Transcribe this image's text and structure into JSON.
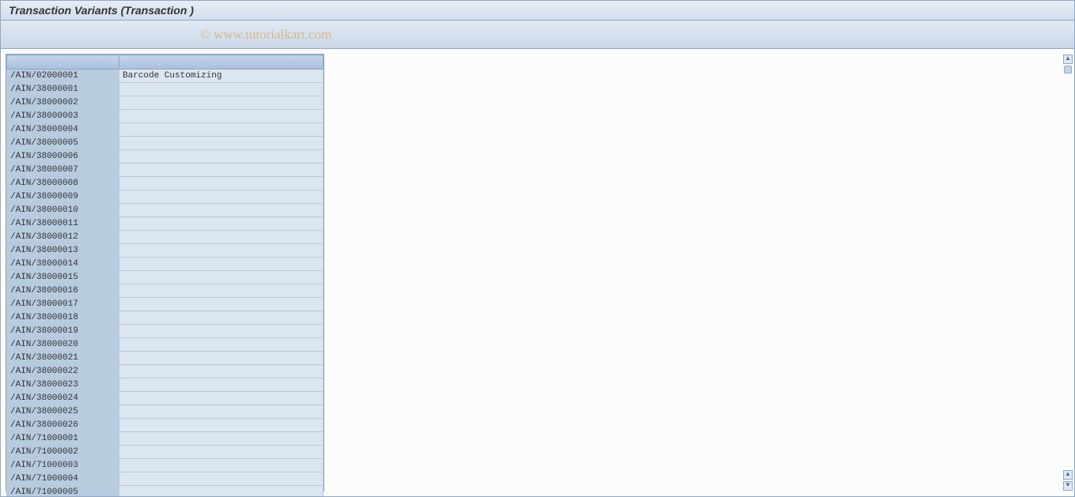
{
  "header": {
    "title": "Transaction Variants (Transaction  )"
  },
  "watermark": "© www.tutorialkart.com",
  "table": {
    "rows": [
      {
        "code": "/AIN/02000001",
        "desc": "Barcode Customizing"
      },
      {
        "code": "/AIN/38000001",
        "desc": ""
      },
      {
        "code": "/AIN/38000002",
        "desc": ""
      },
      {
        "code": "/AIN/38000003",
        "desc": ""
      },
      {
        "code": "/AIN/38000004",
        "desc": ""
      },
      {
        "code": "/AIN/38000005",
        "desc": ""
      },
      {
        "code": "/AIN/38000006",
        "desc": ""
      },
      {
        "code": "/AIN/38000007",
        "desc": ""
      },
      {
        "code": "/AIN/38000008",
        "desc": ""
      },
      {
        "code": "/AIN/38000009",
        "desc": ""
      },
      {
        "code": "/AIN/38000010",
        "desc": ""
      },
      {
        "code": "/AIN/38000011",
        "desc": ""
      },
      {
        "code": "/AIN/38000012",
        "desc": ""
      },
      {
        "code": "/AIN/38000013",
        "desc": ""
      },
      {
        "code": "/AIN/38000014",
        "desc": ""
      },
      {
        "code": "/AIN/38000015",
        "desc": ""
      },
      {
        "code": "/AIN/38000016",
        "desc": ""
      },
      {
        "code": "/AIN/38000017",
        "desc": ""
      },
      {
        "code": "/AIN/38000018",
        "desc": ""
      },
      {
        "code": "/AIN/38000019",
        "desc": ""
      },
      {
        "code": "/AIN/38000020",
        "desc": ""
      },
      {
        "code": "/AIN/38000021",
        "desc": ""
      },
      {
        "code": "/AIN/38000022",
        "desc": ""
      },
      {
        "code": "/AIN/38000023",
        "desc": ""
      },
      {
        "code": "/AIN/38000024",
        "desc": ""
      },
      {
        "code": "/AIN/38000025",
        "desc": ""
      },
      {
        "code": "/AIN/38000026",
        "desc": ""
      },
      {
        "code": "/AIN/71000001",
        "desc": ""
      },
      {
        "code": "/AIN/71000002",
        "desc": ""
      },
      {
        "code": "/AIN/71000003",
        "desc": ""
      },
      {
        "code": "/AIN/71000004",
        "desc": ""
      },
      {
        "code": "/AIN/71000005",
        "desc": ""
      }
    ]
  },
  "scroll": {
    "up": "▲",
    "down": "▼"
  }
}
